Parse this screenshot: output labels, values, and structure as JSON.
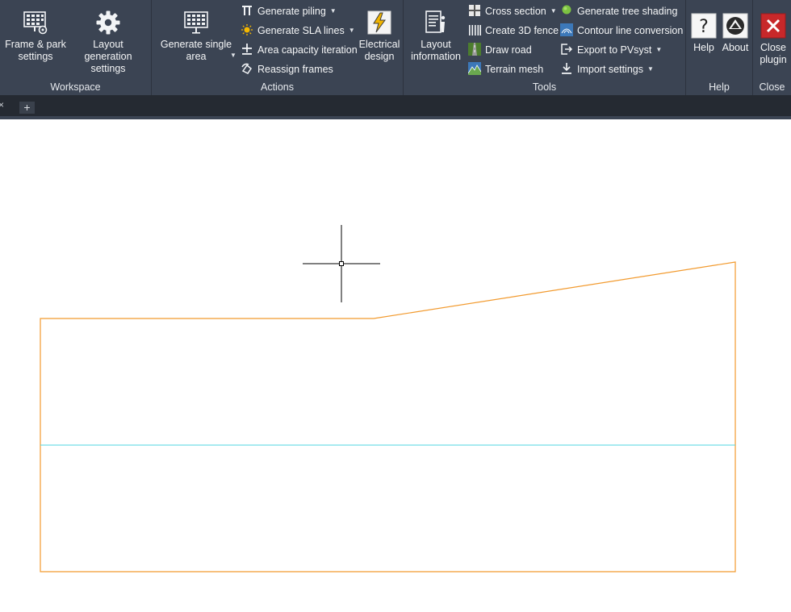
{
  "ribbon": {
    "groups": {
      "workspace": "Workspace",
      "actions": "Actions",
      "tools": "Tools",
      "help": "Help",
      "close": "Close"
    },
    "workspace": {
      "frame_park_line1": "Frame & park",
      "frame_park_line2": "settings",
      "layout_gen_line1": "Layout generation",
      "layout_gen_line2": "settings"
    },
    "actions": {
      "generate_single_line1": "Generate single",
      "generate_single_line2": "area",
      "generate_piling": "Generate piling",
      "generate_sla": "Generate SLA lines",
      "area_capacity": "Area capacity iteration",
      "reassign_frames": "Reassign frames",
      "electrical_line1": "Electrical",
      "electrical_line2": "design"
    },
    "tools": {
      "layout_info_line1": "Layout",
      "layout_info_line2": "information",
      "cross_section": "Cross section",
      "create_fence": "Create 3D fence",
      "draw_road": "Draw road",
      "terrain_mesh": "Terrain mesh",
      "tree_shading": "Generate tree shading",
      "contour_conversion": "Contour line conversion",
      "export_pvsyst": "Export to PVsyst",
      "import_settings": "Import settings"
    },
    "help": {
      "help": "Help",
      "about": "About"
    },
    "close": {
      "line1": "Close",
      "line2": "plugin"
    }
  },
  "tabs": {
    "add": "+",
    "close": "×"
  },
  "colors": {
    "ribbon_bg": "#3b4453",
    "boundary": "#f29a2e",
    "cyan_line": "#4fd6e0",
    "close_red": "#c8282a",
    "lightning": "#f0b400"
  }
}
